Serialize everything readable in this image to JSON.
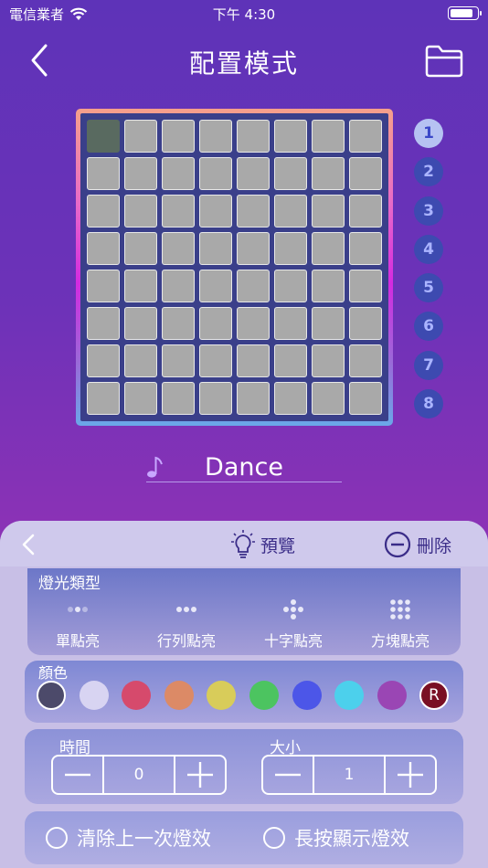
{
  "status_bar": {
    "carrier": "電信業者",
    "time": "下午 4:30",
    "battery_level": 0.9
  },
  "nav": {
    "title": "配置模式",
    "back_icon": "chevron-left-icon",
    "folder_icon": "folder-icon"
  },
  "grid": {
    "rows": 8,
    "cols": 8,
    "active_cells": [
      [
        0,
        0
      ]
    ]
  },
  "pages": {
    "items": [
      "1",
      "2",
      "3",
      "4",
      "5",
      "6",
      "7",
      "8"
    ],
    "selected": "1"
  },
  "song": {
    "name": "Dance",
    "icon": "music-note-icon"
  },
  "panel": {
    "preview_label": "預覽",
    "delete_label": "刪除",
    "light_type": {
      "title": "燈光類型",
      "items": [
        {
          "label": "單點亮",
          "icon": "single-dot-icon"
        },
        {
          "label": "行列點亮",
          "icon": "row-dots-icon"
        },
        {
          "label": "十字點亮",
          "icon": "cross-dots-icon"
        },
        {
          "label": "方塊點亮",
          "icon": "square-dots-icon"
        }
      ]
    },
    "color": {
      "title": "顏色",
      "swatches": [
        "#4c4a6a",
        "#d8d4f2",
        "#d64a6c",
        "#dc8a66",
        "#d8cc5a",
        "#4cc460",
        "#4c56e8",
        "#4cd0ec",
        "#9a46b4"
      ],
      "random_label": "R",
      "random_color": "#7a1024"
    },
    "time": {
      "title": "時間",
      "value": "0"
    },
    "size": {
      "title": "大小",
      "value": "1"
    },
    "options": {
      "clear_last": "清除上一次燈效",
      "long_press": "長按顯示燈效"
    }
  }
}
